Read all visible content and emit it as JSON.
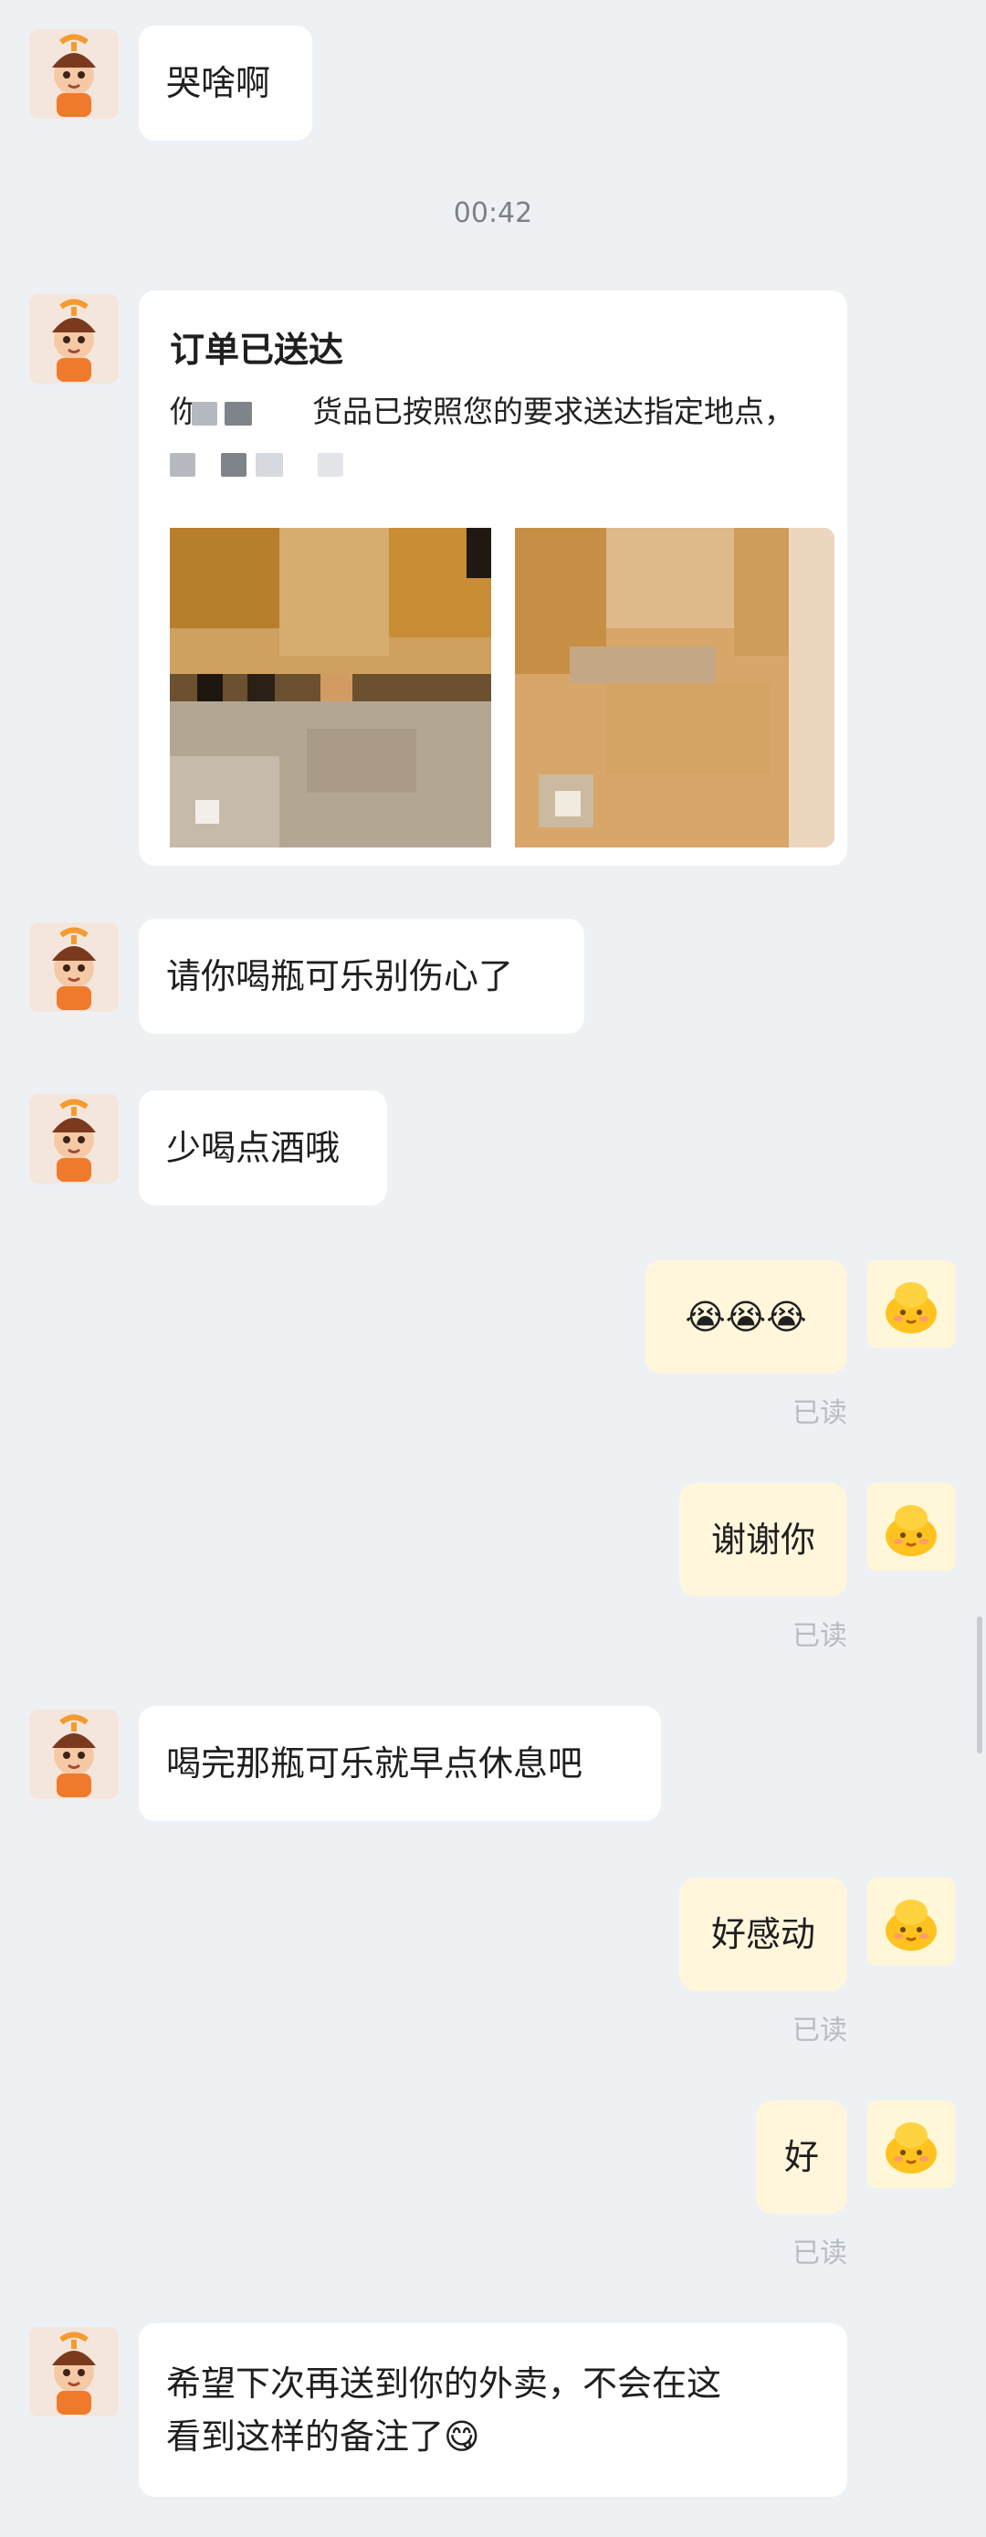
{
  "messages": {
    "m1": "哭啥啊",
    "time1": "00:42",
    "card": {
      "title": "订单已送达",
      "line1_prefix": "你",
      "line1_rest": "货品已按照您的要求送达指定地点，"
    },
    "m2": "请你喝瓶可乐别伤心了",
    "m3": "少喝点酒哦",
    "r1": "😭😭😭",
    "read1": "已读",
    "r2": "谢谢你",
    "read2": "已读",
    "m4": "喝完那瓶可乐就早点休息吧",
    "r3": "好感动",
    "read3": "已读",
    "r4": "好",
    "read4": "已读",
    "m5_line1": "希望下次再送到你的外卖，不会在这",
    "m5_line2": "看到这样的备注了😋"
  },
  "icons": {
    "left_avatar": "delivery-boy-avatar-icon",
    "right_avatar": "yellow-bun-avatar-icon"
  },
  "colors": {
    "background": "#eef1f4",
    "incoming_bubble": "#ffffff",
    "outgoing_bubble": "#fff6dc",
    "read_text": "#b8bcc2"
  }
}
